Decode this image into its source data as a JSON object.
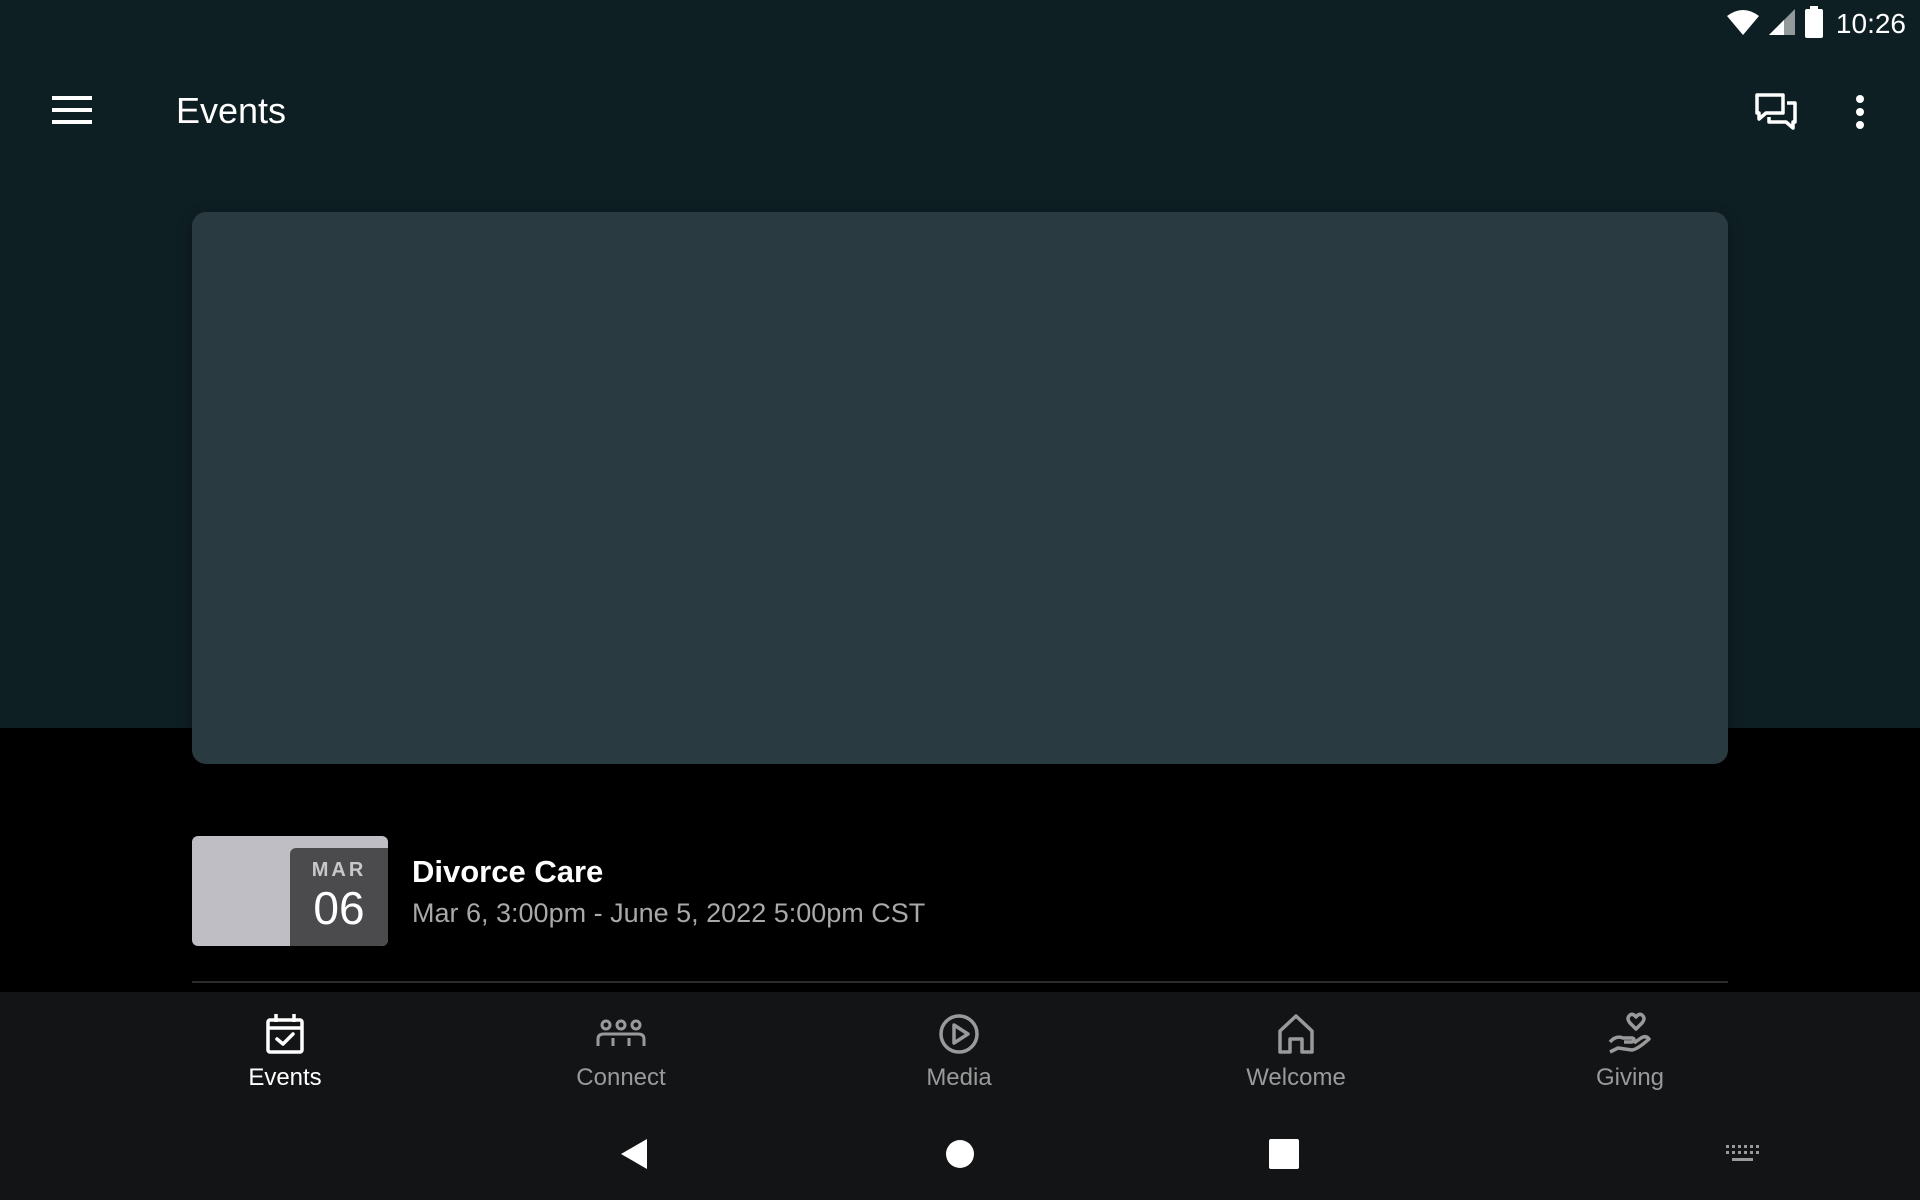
{
  "status_bar": {
    "time": "10:26",
    "icons": [
      "wifi-icon",
      "cell-signal-icon",
      "battery-icon"
    ]
  },
  "app_bar": {
    "title": "Events",
    "icons": [
      "menu-icon",
      "chat-icon",
      "more-vert-icon"
    ]
  },
  "events": [
    {
      "month": "MAR",
      "day": "06",
      "title": "Divorce Care",
      "subtitle": "Mar 6, 3:00pm - June 5, 2022 5:00pm CST"
    }
  ],
  "bottom_nav": {
    "items": [
      {
        "label": "Events",
        "icon": "calendar-check-icon",
        "active": true
      },
      {
        "label": "Connect",
        "icon": "people-group-icon",
        "active": false
      },
      {
        "label": "Media",
        "icon": "play-circle-icon",
        "active": false
      },
      {
        "label": "Welcome",
        "icon": "home-icon",
        "active": false
      },
      {
        "label": "Giving",
        "icon": "hand-heart-icon",
        "active": false
      }
    ]
  },
  "system_nav": {
    "icons": [
      "back-icon",
      "home-circle-icon",
      "recents-icon",
      "keyboard-icon"
    ]
  },
  "colors": {
    "header_bg": "#0e1f24",
    "card_bg": "#293a41",
    "content_bg": "#000000",
    "nav_bg": "#131416",
    "active_label": "#ffffff",
    "inactive_label": "#9a9a9a"
  }
}
